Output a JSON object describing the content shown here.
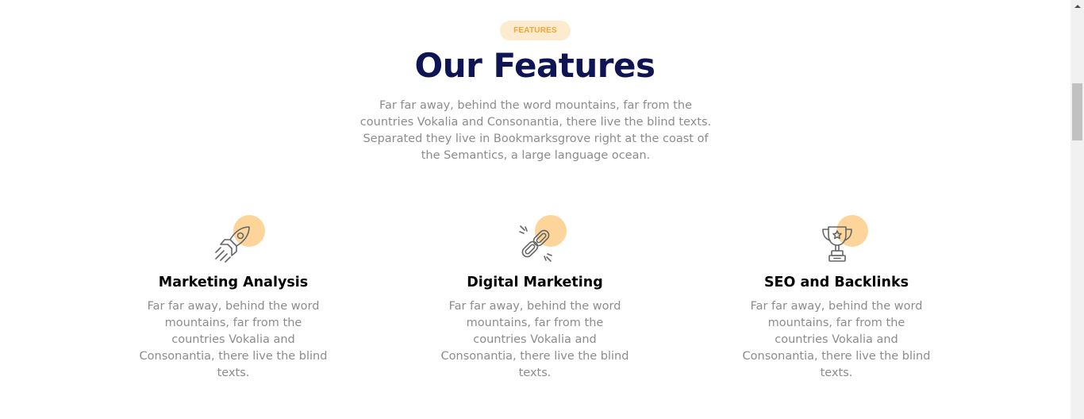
{
  "section": {
    "badge": "FEATURES",
    "title": "Our Features",
    "intro": "Far far away, behind the word mountains, far from the countries Vokalia and Consonantia, there live the blind texts. Separated they live in Bookmarksgrove right at the coast of the Semantics, a large language ocean."
  },
  "features": [
    {
      "icon": "rocket-icon",
      "title": "Marketing Analysis",
      "text": "Far far away, behind the word mountains, far from the countries Vokalia and Consonantia, there live the blind texts."
    },
    {
      "icon": "link-icon",
      "title": "Digital Marketing",
      "text": "Far far away, behind the word mountains, far from the countries Vokalia and Consonantia, there live the blind texts."
    },
    {
      "icon": "trophy-icon",
      "title": "SEO and Backlinks",
      "text": "Far far away, behind the word mountains, far from the countries Vokalia and Consonantia, there live the blind texts."
    }
  ],
  "colors": {
    "title": "#0f1454",
    "accent": "#f3a533",
    "badge_bg": "#fdebd0",
    "icon_dot": "#fdd59a",
    "body_text": "#8c8c8c"
  }
}
